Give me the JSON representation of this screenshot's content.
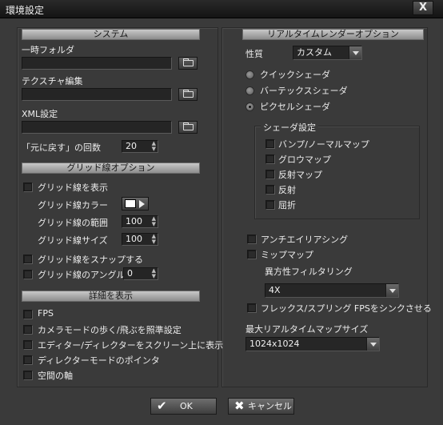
{
  "window": {
    "title": "環境設定",
    "close_glyph": "X"
  },
  "system": {
    "header": "システム",
    "temp_folder_label": "一時フォルダ",
    "temp_folder_value": "",
    "texture_edit_label": "テクスチャ編集",
    "texture_edit_value": "",
    "xml_label": "XML設定",
    "xml_value": "",
    "undo_label": "「元に戻す」の回数",
    "undo_value": "20"
  },
  "grid": {
    "header": "グリッド線オプション",
    "show_label": "グリッド線を表示",
    "color_label": "グリッド線カラー",
    "color_value": "#ffffff",
    "range_label": "グリッド線の範囲",
    "range_value": "100",
    "size_label": "グリッド線サイズ",
    "size_value": "100",
    "snap_label": "グリッド線をスナップする",
    "angle_label": "グリッド線のアングル",
    "angle_value": "0"
  },
  "details": {
    "header": "詳細を表示",
    "items": [
      "FPS",
      "カメラモードの歩く/飛ぶを照準設定",
      "エディター/ディレクターをスクリーン上に表示",
      "ディレクターモードのポインタ",
      "空間の軸"
    ]
  },
  "realtime": {
    "header": "リアルタイムレンダーオプション",
    "quality_label": "性質",
    "quality_value": "カスタム",
    "shaders": [
      "クイックシェーダ",
      "バーテックスシェーダ",
      "ピクセルシェーダ"
    ],
    "selected_shader": 2,
    "shader_settings_label": "シェーダ設定",
    "shader_settings": [
      "バンプ/ノーマルマップ",
      "グロウマップ",
      "反射マップ",
      "反射",
      "屈折"
    ],
    "antialias_label": "アンチエイリアシング",
    "mipmap_label": "ミップマップ",
    "aniso_label": "異方性フィルタリング",
    "aniso_value": "4X",
    "sync_label": "フレックス/スプリング FPSをシンクさせる",
    "max_map_label": "最大リアルタイムマップサイズ",
    "max_map_value": "1024x1024"
  },
  "footer": {
    "ok_label": "OK",
    "ok_icon": "check-icon",
    "cancel_label": "キャンセル",
    "cancel_icon": "x-icon"
  }
}
